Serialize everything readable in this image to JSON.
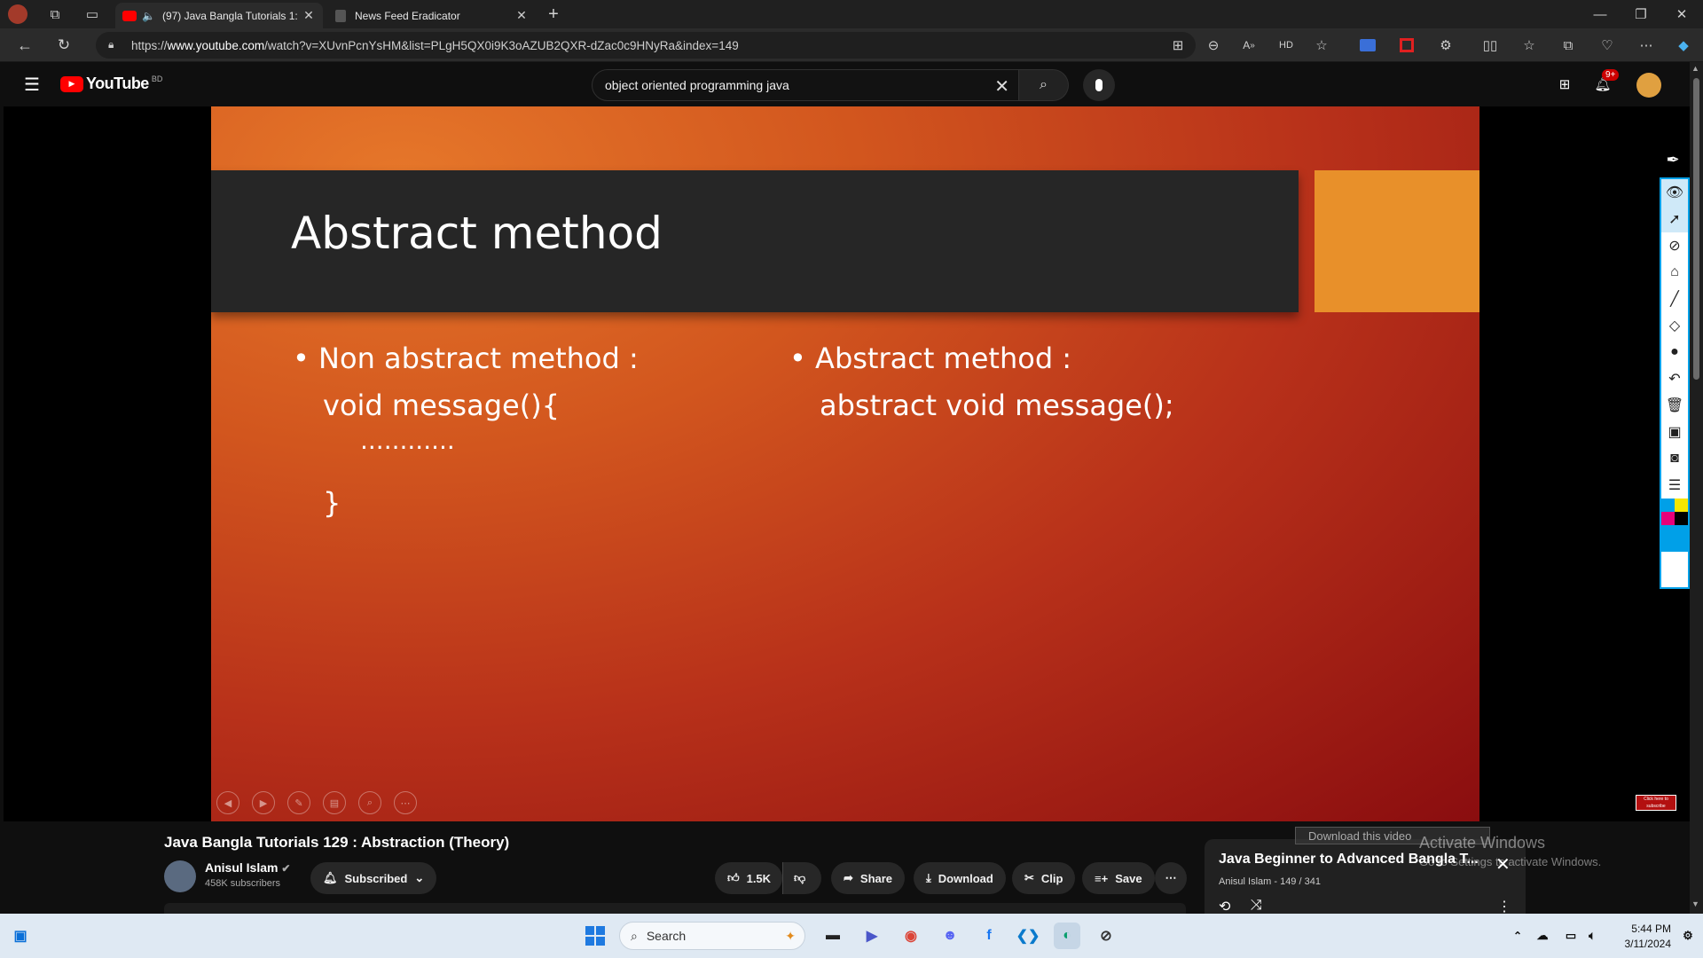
{
  "browser": {
    "tabs": [
      {
        "title": "(97) Java Bangla Tutorials 1:",
        "active": true
      },
      {
        "title": "News Feed Eradicator",
        "active": false
      }
    ],
    "url_prefix": "https://",
    "url_host": "www.youtube.com",
    "url_path": "/watch?v=XUvnPcnYsHM&list=PLgH5QX0i9K3oAZUB2QXR-dZac0c9HNyRa&index=149"
  },
  "youtube": {
    "logo_text": "YouTube",
    "region": "BD",
    "search_value": "object oriented programming java",
    "notifications": "9+"
  },
  "slide": {
    "title": "Abstract method",
    "left_bullet": "Non abstract method :",
    "left_code_1": "void message(){",
    "left_code_2": "............",
    "left_code_3": "}",
    "right_bullet": "Abstract method :",
    "right_code": "abstract void message();",
    "badge": "Click here to subscribe"
  },
  "video": {
    "title": "Java Bangla Tutorials 129 : Abstraction (Theory)",
    "channel": "Anisul Islam",
    "subscribers": "458K subscribers",
    "subscribed_label": "Subscribed",
    "likes": "1.5K",
    "share": "Share",
    "download": "Download",
    "clip": "Clip",
    "save": "Save",
    "download_overlay": "Download this video"
  },
  "playlist": {
    "title": "Java Beginner to Advanced Bangla T...",
    "meta": "Anisul Islam - 149 / 341"
  },
  "watermark": {
    "line1": "Activate Windows",
    "line2": "Go to Settings to activate Windows."
  },
  "taskbar": {
    "search_placeholder": "Search",
    "time": "5:44 PM",
    "date": "3/11/2024"
  }
}
